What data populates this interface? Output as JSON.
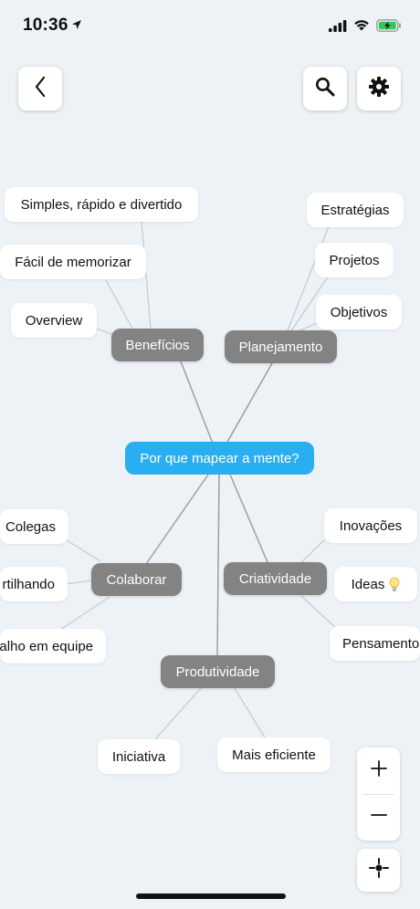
{
  "status_bar": {
    "time": "10:36"
  },
  "map": {
    "root": "Por que mapear a mente?",
    "branches": {
      "beneficios": "Benefícios",
      "planejamento": "Planejamento",
      "colaborar": "Colaborar",
      "criatividade": "Criatividade",
      "produtividade": "Produtividade"
    },
    "leaves": {
      "simples": "Simples, rápido e divertido",
      "facil": "Fácil de memorizar",
      "overview": "Overview",
      "estrategias": "Estratégias",
      "projetos": "Projetos",
      "objetivos": "Objetivos",
      "colegas": "Colegas",
      "compartilhando": "rtilhando",
      "trabalho": "alho em equipe",
      "inovacoes": "Inovações",
      "ideas": "Ideas",
      "pensamento": "Pensamento",
      "iniciativa": "Iniciativa",
      "eficiente": "Mais eficiente"
    }
  },
  "colors": {
    "root": "#2aaef2",
    "branch": "#838383",
    "background": "#edf2f7"
  }
}
